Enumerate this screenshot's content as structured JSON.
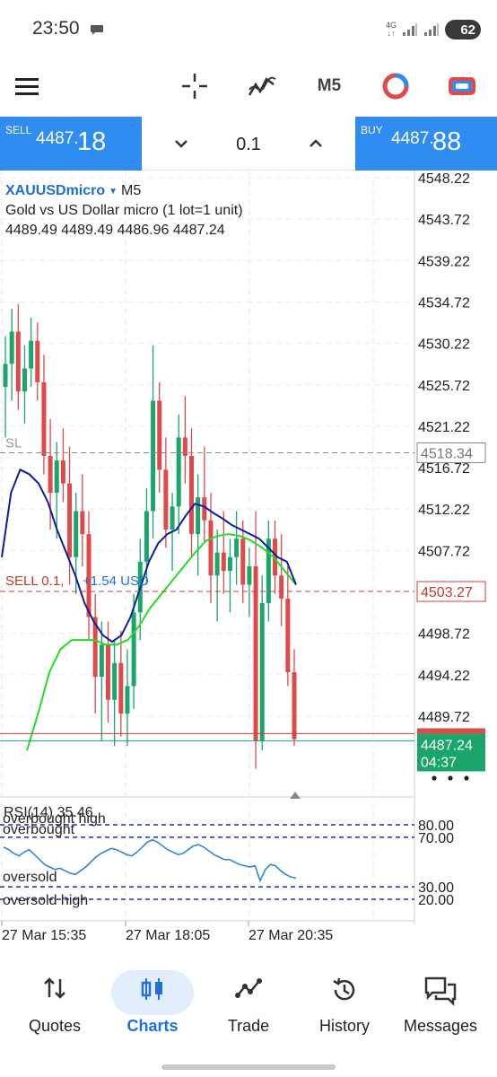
{
  "status_bar": {
    "time": "23:50",
    "network": "4G",
    "battery": "62"
  },
  "toolbar": {
    "timeframe": "M5",
    "icons": [
      "menu-icon",
      "crosshair-icon",
      "indicators-icon",
      "timeframe-label",
      "one-click-trading-icon",
      "trade-levels-icon"
    ]
  },
  "trade_bar": {
    "sell_label": "SELL",
    "sell_price_main": "4487.",
    "sell_price_big": "18",
    "buy_label": "BUY",
    "buy_price_main": "4487.",
    "buy_price_big": "88",
    "lot": "0.1"
  },
  "chart_header": {
    "symbol": "XAUUSDmicro",
    "timeframe": "M5",
    "description": "Gold vs US Dollar micro (1 lot=1 unit)",
    "ohlc": "4489.49 4489.49 4486.96 4487.24"
  },
  "chart_data": {
    "type": "candlestick",
    "price_axis_ticks": [
      "4548.22",
      "4543.72",
      "4539.22",
      "4534.72",
      "4530.22",
      "4525.72",
      "4521.22",
      "4516.72",
      "4512.22",
      "4507.72",
      "4503.27",
      "4498.72",
      "4494.22",
      "4489.72"
    ],
    "ylim": [
      4480.0,
      4550.0
    ],
    "levels": {
      "sl": {
        "label": "SL",
        "price": "4518.34"
      },
      "position": {
        "label": "SELL 0.1,",
        "profit": "+1.54 USD",
        "price": "4503.27"
      },
      "current_price": "4487.24",
      "countdown": "04:37"
    },
    "time_labels": [
      "27 Mar 15:35",
      "27 Mar 18:05",
      "27 Mar 20:35"
    ],
    "rsi": {
      "title": "RSI(14) 35.46",
      "levels": [
        {
          "label": "overbought high",
          "value": "80.00"
        },
        {
          "label": "overbought",
          "value": "70.00"
        },
        {
          "label": "oversold",
          "value": "30.00"
        },
        {
          "label": "oversold high",
          "value": "20.00"
        }
      ],
      "ylim": [
        0,
        100
      ],
      "values": [
        62,
        60,
        57,
        55,
        58,
        60,
        56,
        52,
        48,
        46,
        44,
        45,
        43,
        41,
        40,
        43,
        46,
        50,
        54,
        57,
        59,
        61,
        60,
        58,
        56,
        55,
        58,
        62,
        66,
        68,
        66,
        63,
        60,
        58,
        56,
        57,
        60,
        63,
        64,
        62,
        59,
        56,
        54,
        52,
        52,
        50,
        48,
        47,
        46,
        47,
        35,
        44,
        48,
        47,
        43,
        40,
        38,
        37
      ]
    },
    "candles": [
      {
        "o": 4525.5,
        "h": 4531.0,
        "l": 4520.0,
        "c": 4528.0
      },
      {
        "o": 4528.0,
        "h": 4534.0,
        "l": 4524.0,
        "c": 4531.5
      },
      {
        "o": 4531.5,
        "h": 4534.5,
        "l": 4523.0,
        "c": 4525.0
      },
      {
        "o": 4525.0,
        "h": 4530.0,
        "l": 4521.5,
        "c": 4527.5
      },
      {
        "o": 4527.5,
        "h": 4533.0,
        "l": 4525.5,
        "c": 4530.5
      },
      {
        "o": 4530.5,
        "h": 4532.5,
        "l": 4524.0,
        "c": 4526.0
      },
      {
        "o": 4526.0,
        "h": 4529.0,
        "l": 4516.0,
        "c": 4518.0
      },
      {
        "o": 4518.0,
        "h": 4522.0,
        "l": 4510.0,
        "c": 4514.0
      },
      {
        "o": 4514.0,
        "h": 4519.5,
        "l": 4509.0,
        "c": 4517.5
      },
      {
        "o": 4517.5,
        "h": 4521.0,
        "l": 4513.0,
        "c": 4515.0
      },
      {
        "o": 4515.0,
        "h": 4519.0,
        "l": 4504.0,
        "c": 4507.0
      },
      {
        "o": 4507.0,
        "h": 4514.0,
        "l": 4503.0,
        "c": 4512.0
      },
      {
        "o": 4512.0,
        "h": 4516.0,
        "l": 4506.0,
        "c": 4509.5
      },
      {
        "o": 4509.5,
        "h": 4512.0,
        "l": 4498.0,
        "c": 4500.5
      },
      {
        "o": 4500.5,
        "h": 4503.0,
        "l": 4490.0,
        "c": 4494.0
      },
      {
        "o": 4494.0,
        "h": 4500.0,
        "l": 4487.0,
        "c": 4497.5
      },
      {
        "o": 4497.5,
        "h": 4500.0,
        "l": 4489.0,
        "c": 4491.5
      },
      {
        "o": 4491.5,
        "h": 4498.0,
        "l": 4486.5,
        "c": 4495.5
      },
      {
        "o": 4495.5,
        "h": 4499.0,
        "l": 4487.5,
        "c": 4490.0
      },
      {
        "o": 4490.0,
        "h": 4497.0,
        "l": 4486.5,
        "c": 4493.0
      },
      {
        "o": 4493.0,
        "h": 4503.0,
        "l": 4490.5,
        "c": 4501.0
      },
      {
        "o": 4501.0,
        "h": 4509.0,
        "l": 4498.0,
        "c": 4506.5
      },
      {
        "o": 4506.5,
        "h": 4514.5,
        "l": 4504.0,
        "c": 4512.0
      },
      {
        "o": 4512.0,
        "h": 4530.0,
        "l": 4509.0,
        "c": 4524.0
      },
      {
        "o": 4524.0,
        "h": 4526.0,
        "l": 4514.0,
        "c": 4516.5
      },
      {
        "o": 4516.5,
        "h": 4520.0,
        "l": 4508.0,
        "c": 4510.0
      },
      {
        "o": 4510.0,
        "h": 4514.0,
        "l": 4505.5,
        "c": 4512.5
      },
      {
        "o": 4512.5,
        "h": 4522.5,
        "l": 4509.5,
        "c": 4520.0
      },
      {
        "o": 4520.0,
        "h": 4524.5,
        "l": 4515.0,
        "c": 4518.0
      },
      {
        "o": 4518.0,
        "h": 4521.0,
        "l": 4507.0,
        "c": 4509.5
      },
      {
        "o": 4509.5,
        "h": 4516.0,
        "l": 4505.0,
        "c": 4513.5
      },
      {
        "o": 4513.5,
        "h": 4519.0,
        "l": 4508.5,
        "c": 4511.0
      },
      {
        "o": 4511.0,
        "h": 4514.0,
        "l": 4502.0,
        "c": 4505.0
      },
      {
        "o": 4505.0,
        "h": 4510.0,
        "l": 4500.0,
        "c": 4507.5
      },
      {
        "o": 4507.5,
        "h": 4512.0,
        "l": 4503.0,
        "c": 4505.5
      },
      {
        "o": 4505.5,
        "h": 4509.0,
        "l": 4501.0,
        "c": 4507.0
      },
      {
        "o": 4507.0,
        "h": 4512.0,
        "l": 4504.0,
        "c": 4509.0
      },
      {
        "o": 4509.0,
        "h": 4511.0,
        "l": 4502.0,
        "c": 4504.0
      },
      {
        "o": 4504.0,
        "h": 4508.0,
        "l": 4500.5,
        "c": 4506.0
      },
      {
        "o": 4506.0,
        "h": 4512.0,
        "l": 4484.0,
        "c": 4487.0
      },
      {
        "o": 4487.0,
        "h": 4505.0,
        "l": 4486.0,
        "c": 4502.0
      },
      {
        "o": 4502.0,
        "h": 4511.0,
        "l": 4500.0,
        "c": 4509.0
      },
      {
        "o": 4509.0,
        "h": 4511.0,
        "l": 4503.0,
        "c": 4505.0
      },
      {
        "o": 4505.0,
        "h": 4509.5,
        "l": 4499.5,
        "c": 4502.5
      },
      {
        "o": 4502.5,
        "h": 4506.0,
        "l": 4493.0,
        "c": 4494.5
      },
      {
        "o": 4494.5,
        "h": 4497.0,
        "l": 4486.5,
        "c": 4487.24
      }
    ],
    "ma_fast_color": "#0a1fa0",
    "ma_slow_color": "#22dd22",
    "ma_fast": [
      4507,
      4514,
      4516.5,
      4516,
      4515,
      4513,
      4510,
      4507.5,
      4505,
      4502,
      4500,
      4498.5,
      4497.8,
      4498.5,
      4500.5,
      4503.5,
      4506.5,
      4508.5,
      4509.5,
      4510,
      4511.5,
      4512.8,
      4512.5,
      4511.8,
      4511.2,
      4510.5,
      4510,
      4509.5,
      4509,
      4508,
      4507,
      4506.5,
      4504
    ],
    "ma_slow": [
      4486,
      4490,
      4494.5,
      4497,
      4498,
      4498,
      4498,
      4497.5,
      4497.5,
      4498,
      4499.5,
      4501.5,
      4503,
      4504.5,
      4506,
      4507.5,
      4508.8,
      4509.3,
      4509.5,
      4509.3,
      4508.8,
      4508,
      4507,
      4505.5,
      4504
    ],
    "bull_color": "#1aa56b",
    "bear_color": "#e0494a"
  },
  "bottom_nav": {
    "items": [
      {
        "label": "Quotes"
      },
      {
        "label": "Charts"
      },
      {
        "label": "Trade"
      },
      {
        "label": "History"
      },
      {
        "label": "Messages"
      }
    ]
  }
}
